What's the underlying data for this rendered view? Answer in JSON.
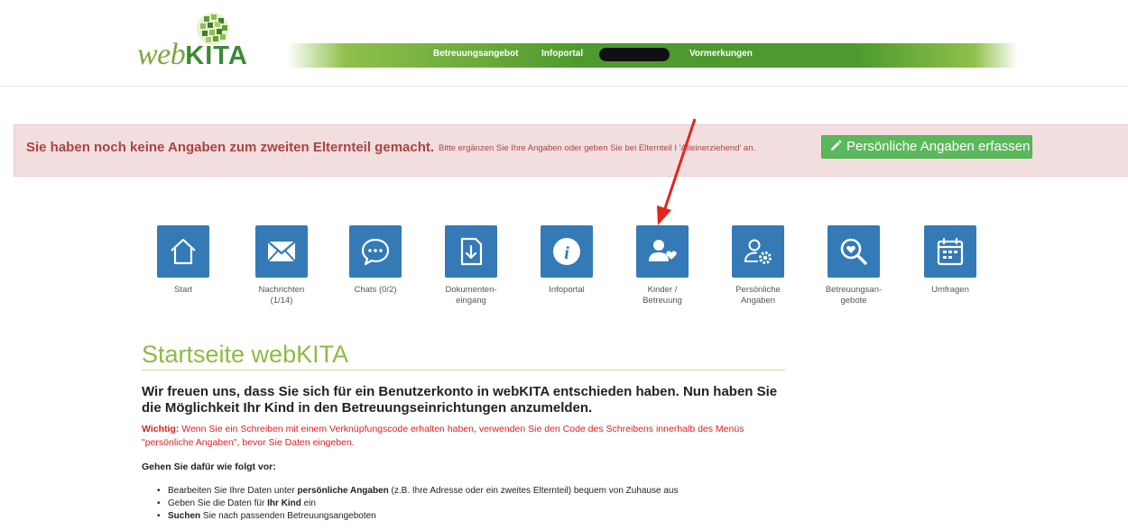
{
  "logo": {
    "web": "web",
    "kita": "KITA"
  },
  "nav": [
    {
      "label": "Betreuungsangebot"
    },
    {
      "label": "Infoportal"
    },
    {
      "label": "Vormerkungen"
    }
  ],
  "alert": {
    "strong": "Sie haben noch keine Angaben zum zweiten Elternteil gemacht.",
    "small": "Bitte ergänzen Sie Ihre Angaben oder geben Sie bei Elternteil I 'Alleinerziehend' an.",
    "button": "Persönliche Angaben erfassen"
  },
  "tiles": [
    {
      "label": "Start",
      "icon": "home-icon"
    },
    {
      "label": "Nachrichten\n(1/14)",
      "icon": "envelope-icon"
    },
    {
      "label": "Chats (0/2)",
      "icon": "chat-icon"
    },
    {
      "label": "Dokumenten-\neingang",
      "icon": "document-download-icon"
    },
    {
      "label": "Infoportal",
      "icon": "info-icon"
    },
    {
      "label": "Kinder /\nBetreuung",
      "icon": "user-heart-icon"
    },
    {
      "label": "Persönliche\nAngaben",
      "icon": "user-settings-icon"
    },
    {
      "label": "Betreuungsan-\ngebote",
      "icon": "search-heart-icon"
    },
    {
      "label": "Umfragen",
      "icon": "calendar-icon"
    }
  ],
  "content": {
    "heading": "Startseite webKITA",
    "intro": "Wir freuen uns, dass Sie sich für ein Benutzerkonto in webKITA entschieden haben. Nun haben Sie die Möglichkeit Ihr Kind in den Betreuungseinrichtungen anzumelden.",
    "warning_label": "Wichtig:",
    "warning_text": " Wenn Sie ein Schreiben mit einem Verknüpfungscode erhalten haben, verwenden Sie den Code des Schreibens innerhalb des Menüs \"persönliche Angaben\", bevor Sie Daten eingeben.",
    "steps_title": "Gehen Sie dafür wie folgt vor:",
    "steps": [
      {
        "pre": "Bearbeiten Sie Ihre Daten unter ",
        "bold": "persönliche Angaben",
        "post": " (z.B. Ihre Adresse oder ein zweites Elternteil) bequem von Zuhause aus"
      },
      {
        "pre": "Geben Sie die Daten für ",
        "bold": "Ihr Kind",
        "post": " ein"
      },
      {
        "pre": "",
        "bold": "Suchen",
        "post": " Sie nach passenden Betreuungsangeboten"
      }
    ]
  },
  "colors": {
    "tile": "#337ab7",
    "brand_green": "#4e9a2e",
    "heading_green": "#8dbb45",
    "alert_bg": "#f2dede",
    "alert_text": "#a94442",
    "button_green": "#5cb85c",
    "warning_red": "#e02020",
    "arrow_red": "#e3261c"
  }
}
